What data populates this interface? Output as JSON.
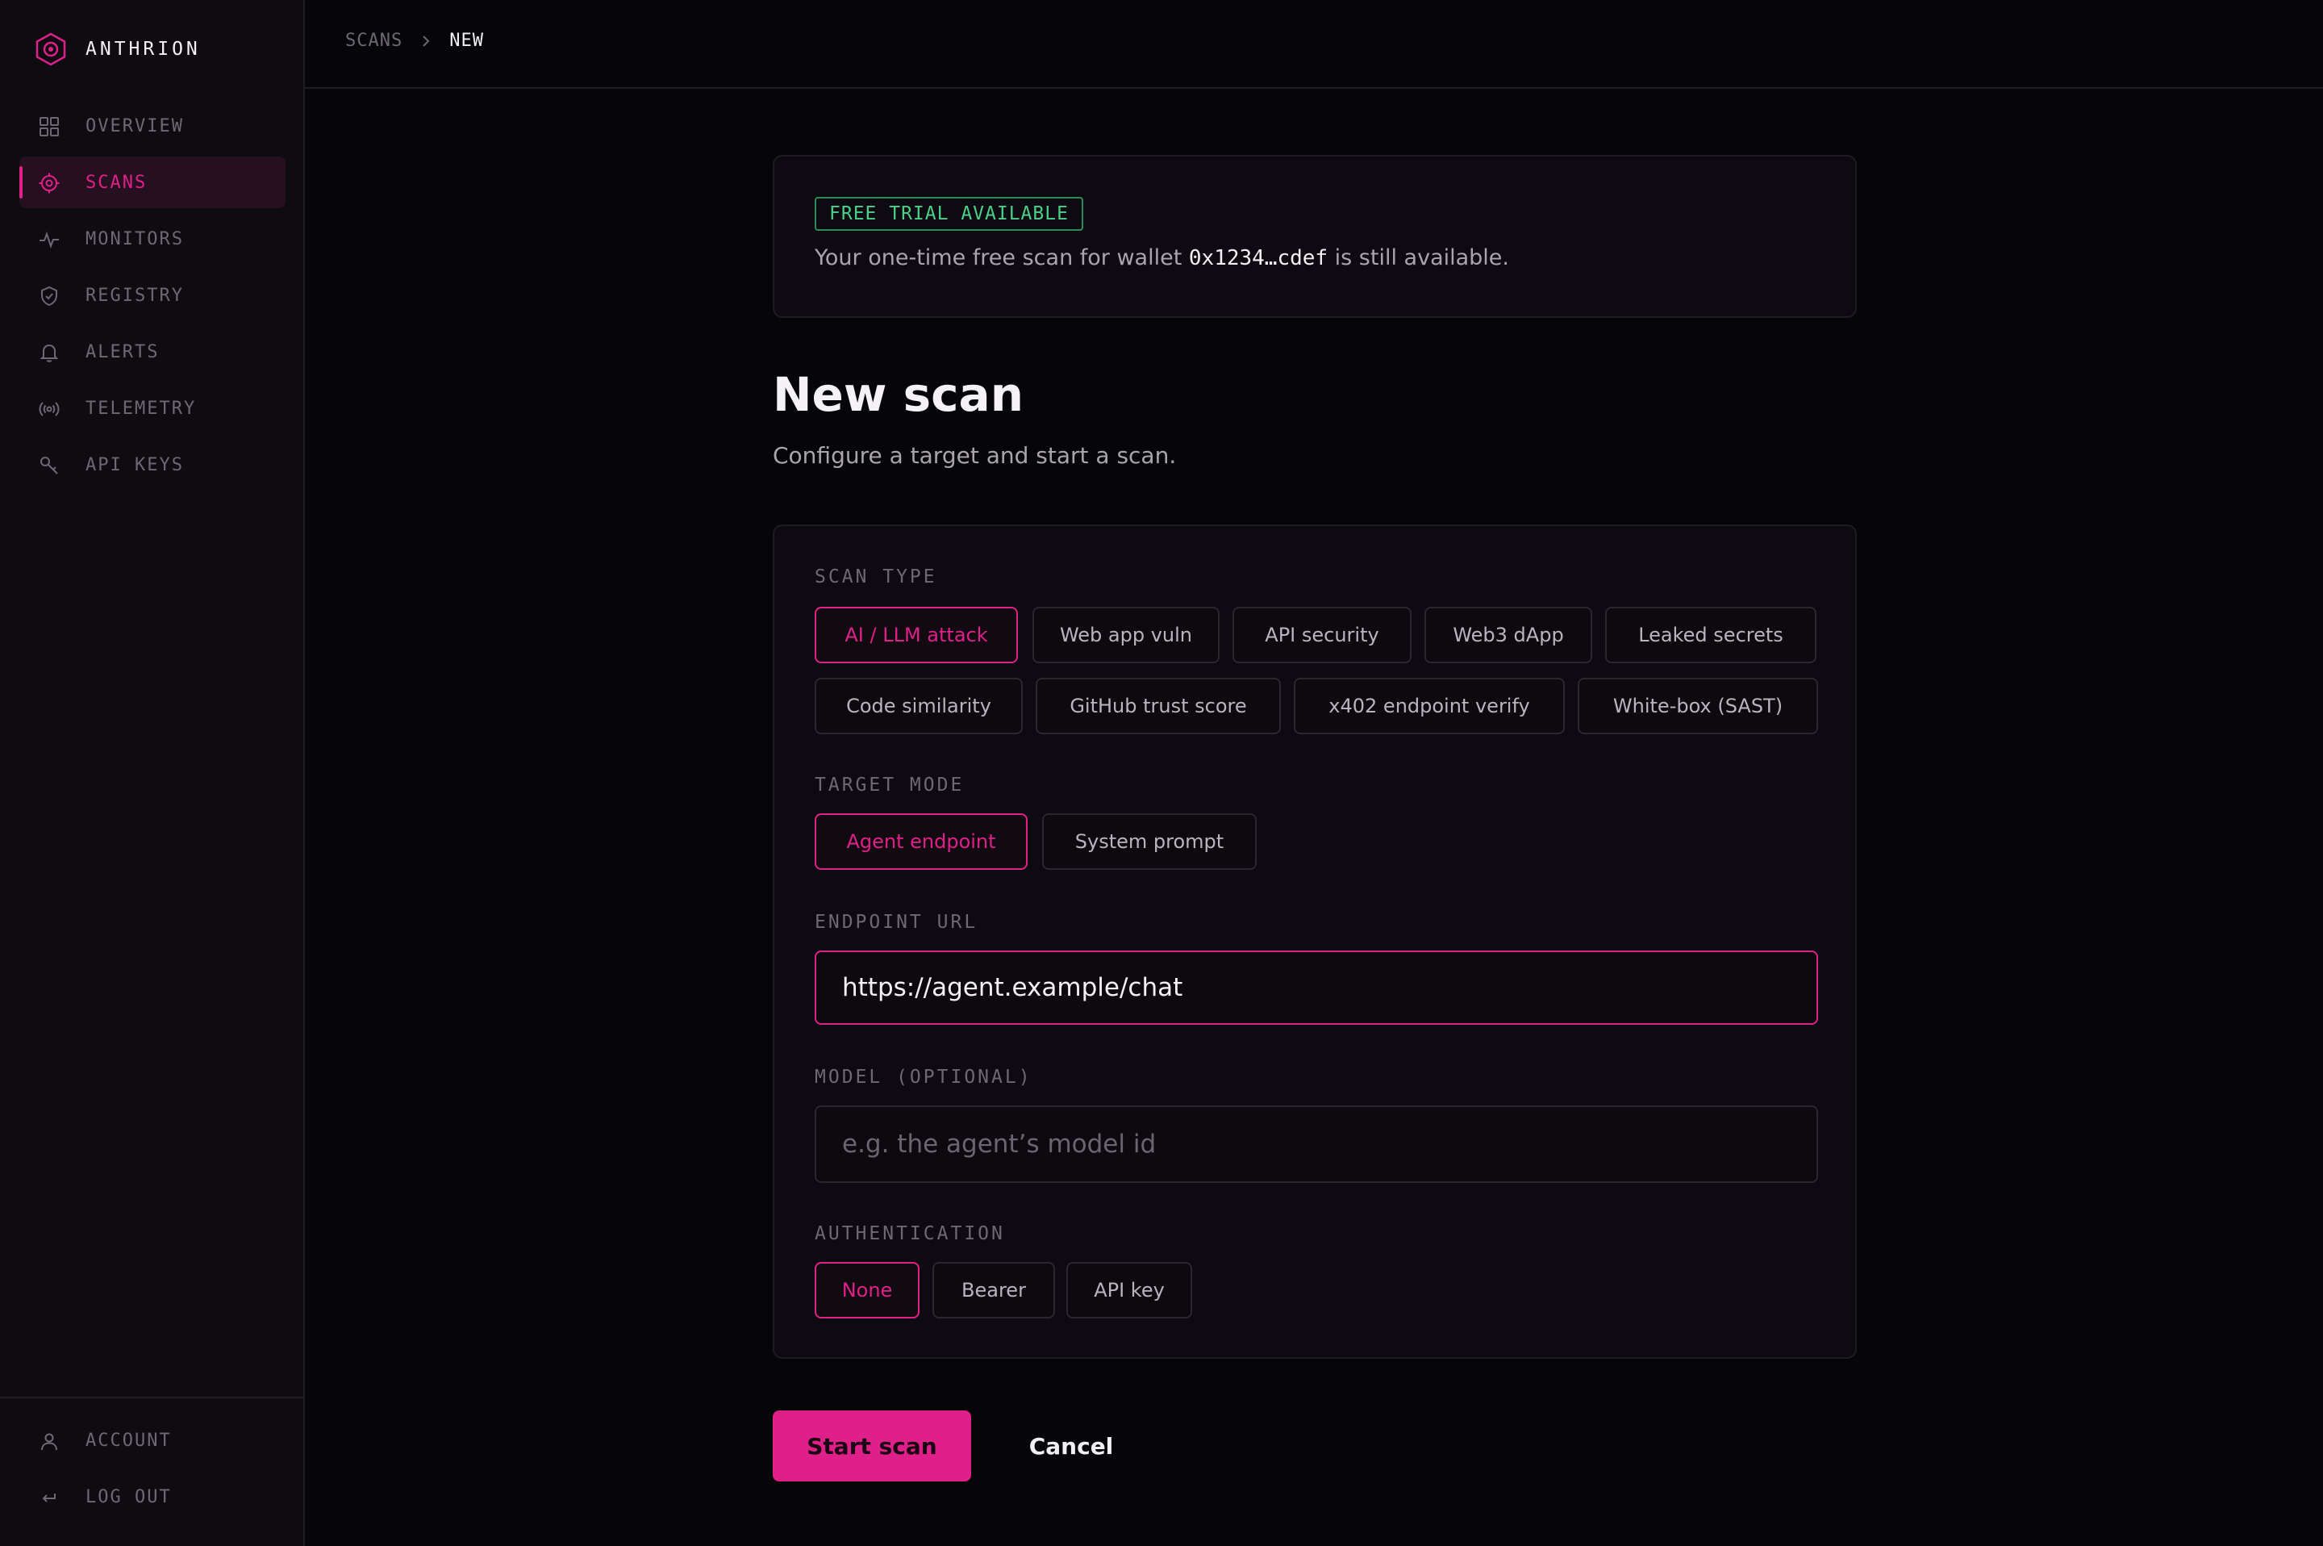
{
  "app": {
    "name": "ANTHRION",
    "accent": "#e0208a",
    "success": "#4bd08a"
  },
  "sidebar": {
    "items": [
      {
        "label": "OVERVIEW",
        "icon": "grid-icon"
      },
      {
        "label": "SCANS",
        "icon": "target-icon",
        "active": true
      },
      {
        "label": "MONITORS",
        "icon": "pulse-icon"
      },
      {
        "label": "REGISTRY",
        "icon": "shield-check-icon"
      },
      {
        "label": "ALERTS",
        "icon": "bell-icon"
      },
      {
        "label": "TELEMETRY",
        "icon": "broadcast-icon"
      },
      {
        "label": "API KEYS",
        "icon": "key-icon"
      }
    ],
    "footer": [
      {
        "label": "ACCOUNT",
        "icon": "user-icon"
      },
      {
        "label": "LOG OUT",
        "icon": "logout-arrow-icon"
      }
    ]
  },
  "breadcrumb": {
    "parent": "SCANS",
    "current": "NEW"
  },
  "trial": {
    "badge": "FREE TRIAL AVAILABLE",
    "text_before": "Your one-time free scan for wallet ",
    "wallet": "0x1234…cdef",
    "text_after": " is still available."
  },
  "page": {
    "title": "New scan",
    "subtitle": "Configure a target and start a scan."
  },
  "form": {
    "scan_type": {
      "label": "SCAN TYPE",
      "options": [
        "AI / LLM attack",
        "Web app vuln",
        "API security",
        "Web3 dApp",
        "Leaked secrets",
        "Code similarity",
        "GitHub trust score",
        "x402 endpoint verify",
        "White-box (SAST)"
      ],
      "selected": "AI / LLM attack"
    },
    "target_mode": {
      "label": "TARGET MODE",
      "options": [
        "Agent endpoint",
        "System prompt"
      ],
      "selected": "Agent endpoint"
    },
    "endpoint_url": {
      "label": "ENDPOINT URL",
      "value": "https://agent.example/chat"
    },
    "model": {
      "label": "MODEL (OPTIONAL)",
      "value": "",
      "placeholder": "e.g. the agent’s model id"
    },
    "authentication": {
      "label": "AUTHENTICATION",
      "options": [
        "None",
        "Bearer",
        "API key"
      ],
      "selected": "None"
    }
  },
  "actions": {
    "start": "Start scan",
    "cancel": "Cancel"
  }
}
